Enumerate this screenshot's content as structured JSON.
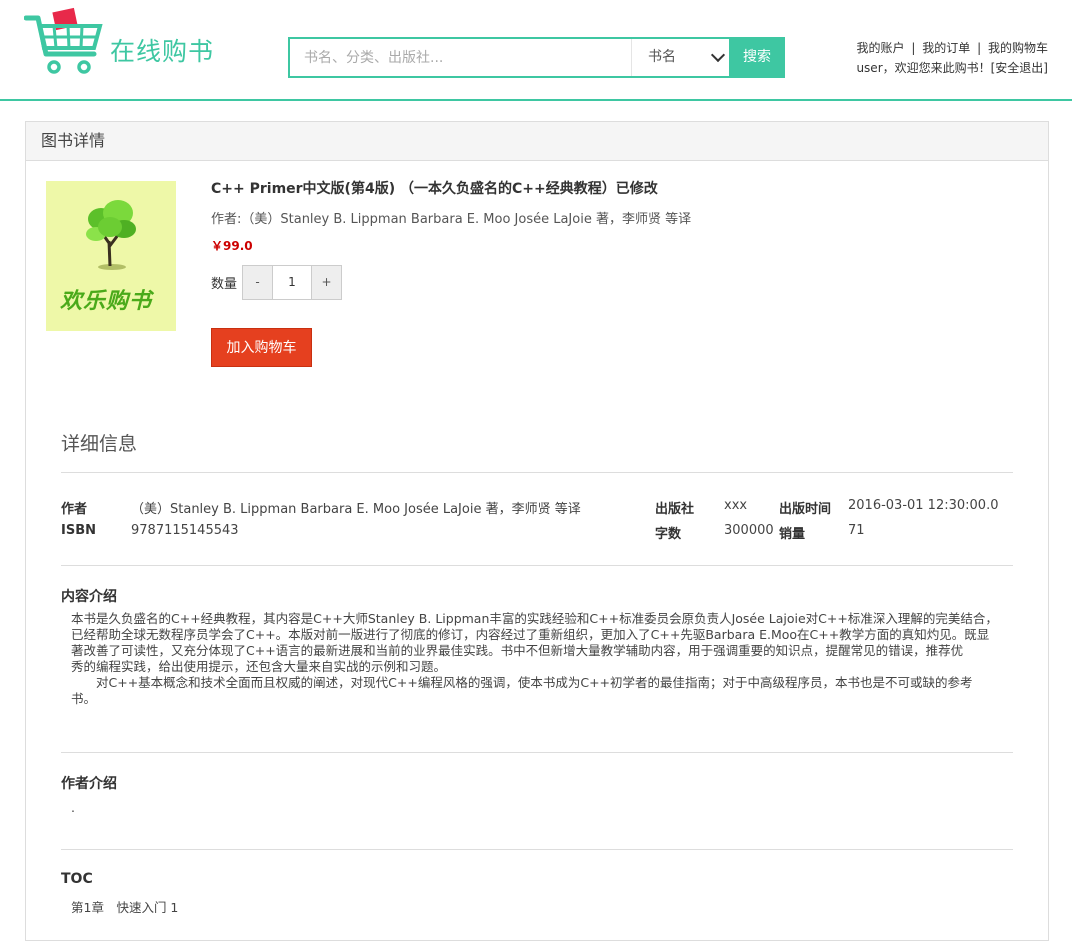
{
  "header": {
    "logo_text": "在线购书",
    "search": {
      "placeholder": "书名、分类、出版社...",
      "select_value": "书名",
      "button_label": "搜索"
    },
    "links": {
      "account": "我的账户",
      "orders": "我的订单",
      "cart": "我的购物车",
      "sep": "|"
    },
    "welcome": "user，欢迎您来此购书！[安全退出]"
  },
  "panel": {
    "title": "图书详情"
  },
  "book": {
    "title": "C++ Primer中文版(第4版)  （一本久负盛名的C++经典教程）已修改",
    "author_line": "作者:（美）Stanley B. Lippman Barbara E. Moo Josée LaJoie 著，李师贤 等译",
    "price": "￥99.0",
    "qty_label": "数量",
    "qty_minus": "-",
    "qty_value": "1",
    "qty_plus": "+",
    "add_to_cart": "加入购物车",
    "cover_text": "欢乐购书"
  },
  "details": {
    "heading": "详细信息",
    "author_label": "作者",
    "author_value": "（美）Stanley B. Lippman Barbara E. Moo Josée LaJoie 著，李师贤 等译",
    "isbn_label": "ISBN",
    "isbn_value": "9787115145543",
    "publisher_label": "出版社",
    "publisher_value": "xxx",
    "pubtime_label": "出版时间",
    "pubtime_value": "2016-03-01 12:30:00.0",
    "words_label": "字数",
    "words_value": "300000",
    "sales_label": "销量",
    "sales_value": "71"
  },
  "intro": {
    "title": "内容介绍",
    "para1_line1": "本书是久负盛名的C++经典教程，其内容是C++大师Stanley B. Lippman丰富的实践经验和C++标准委员会原负责人Josée Lajoie对C++标准深入理解的完美结合，",
    "para1_line2": "已经帮助全球无数程序员学会了C++。本版对前一版进行了彻底的修订，内容经过了重新组织，更加入了C++先驱Barbara E.Moo在C++教学方面的真知灼见。既显",
    "para1_line3": "著改善了可读性，又充分体现了C++语言的最新进展和当前的业界最佳实践。书中不但新增大量教学辅助内容，用于强调重要的知识点，提醒常见的错误，推荐优",
    "para1_line4": "秀的编程实践，给出使用提示，还包含大量来自实战的示例和习题。",
    "para2_line1": "对C++基本概念和技术全面而且权威的阐述，对现代C++编程风格的强调，使本书成为C++初学者的最佳指南；对于中高级程序员，本书也是不可或缺的参考",
    "para2_line2": "书。"
  },
  "author_intro": {
    "title": "作者介绍",
    "text": "."
  },
  "toc": {
    "title": "TOC",
    "line1": "第1章　快速入门 1"
  },
  "colors": {
    "accent": "#3ec7a2",
    "cart_button": "#e5401f",
    "price": "#cc0000"
  },
  "icons": {
    "logo": "shopping-cart-icon",
    "select_arrow": "chevron-down-icon"
  }
}
